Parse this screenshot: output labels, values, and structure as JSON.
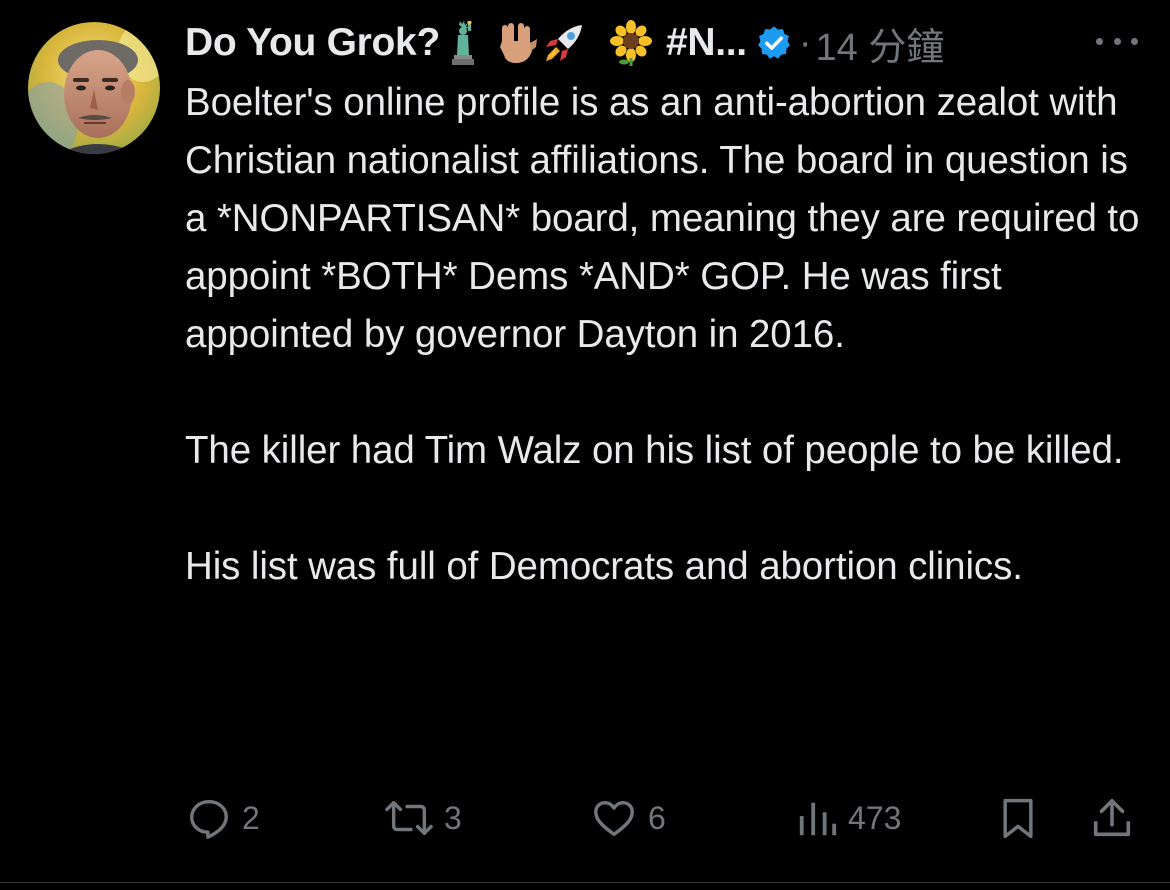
{
  "author": {
    "display_name": "Do You Grok?",
    "name_suffix": "#N...",
    "verified_color": "#1d9bf0",
    "emojis": [
      "statue-of-liberty",
      "vulcan-salute",
      "rocket",
      "sunflower"
    ]
  },
  "meta": {
    "separator": "·",
    "timestamp": "14 分鐘"
  },
  "body": {
    "paragraphs": [
      "Boelter's online profile is as an anti-abortion zealot with Christian nationalist affiliations. The board in question is a *NONPARTISAN* board, meaning they are required to appoint *BOTH* Dems *AND* GOP. He was first appointed by governor Dayton in 2016.",
      "The killer had Tim Walz on his list of people to be killed.",
      "His list was full of Democrats and abortion clinics."
    ]
  },
  "actions": {
    "reply": {
      "icon": "reply-icon",
      "count": "2"
    },
    "repost": {
      "icon": "repost-icon",
      "count": "3"
    },
    "like": {
      "icon": "heart-icon",
      "count": "6"
    },
    "views": {
      "icon": "views-icon",
      "count": "473"
    },
    "bookmark": {
      "icon": "bookmark-icon"
    },
    "share": {
      "icon": "share-icon"
    }
  },
  "colors": {
    "background": "#000000",
    "text": "#e7e9ea",
    "muted": "#71767b",
    "accent": "#1d9bf0"
  }
}
